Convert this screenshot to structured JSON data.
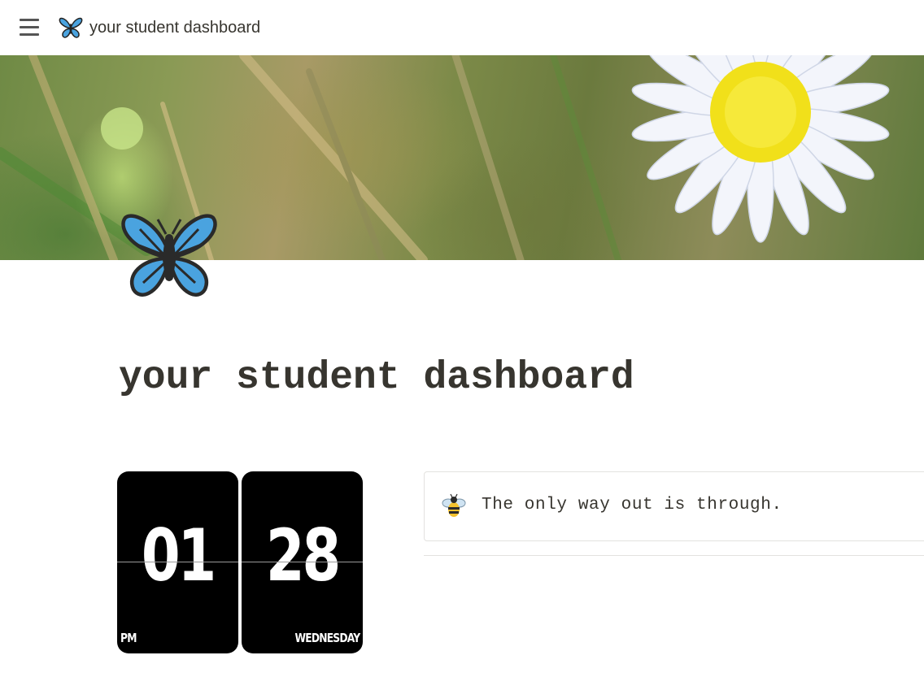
{
  "topbar": {
    "menu_icon": "hamburger-menu-icon",
    "breadcrumb_icon": "butterfly-icon",
    "breadcrumb_title": "your student dashboard"
  },
  "cover": {
    "description_icon": "cover-image"
  },
  "page": {
    "icon": "butterfly-icon",
    "title": "your student dashboard"
  },
  "clock": {
    "hours": "01",
    "minutes": "28",
    "period": "PM",
    "day": "WEDNESDAY"
  },
  "callout": {
    "icon": "bee-icon",
    "text": "The only way out is through."
  },
  "colors": {
    "text": "#37352f",
    "butterfly_blue": "#4aa3df",
    "daisy_yellow": "#f1e01a"
  }
}
